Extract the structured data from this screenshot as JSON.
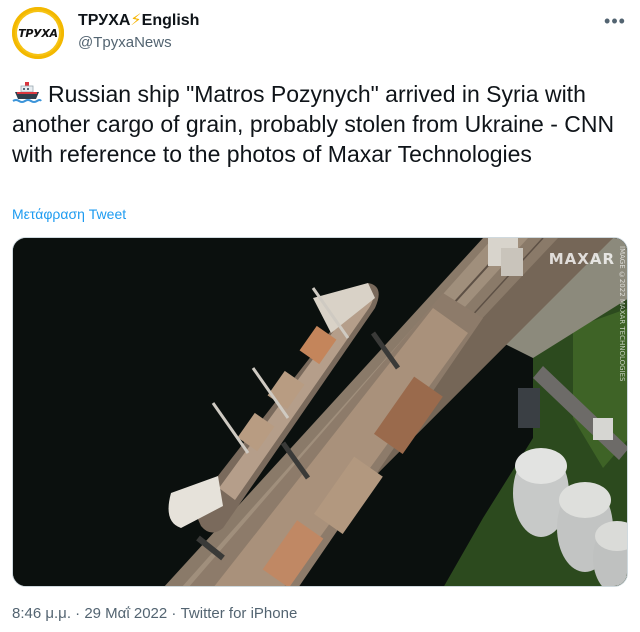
{
  "author": {
    "display_name": "ТРУХА",
    "display_suffix": "English",
    "handle": "@TpyxaNews",
    "avatar_text": "ТРУХА"
  },
  "more_icon": "ellipsis-icon",
  "tweet": {
    "text": "Russian ship \"Matros Pozynych\" arrived in Syria with another cargo of grain, probably stolen from Ukraine - CNN with reference to the photos of Maxar Technologies",
    "emoji_icon": "ship-icon",
    "translate_label": "Μετάφραση Tweet"
  },
  "media": {
    "watermark": "MAXAR",
    "credit_vertical": "IMAGE ©2022 MAXAR TECHNOLOGIES"
  },
  "meta": {
    "time": "8:46 μ.μ.",
    "date": "29 Μαΐ 2022",
    "source": "Twitter for iPhone",
    "separator": " · "
  },
  "colors": {
    "link": "#1d9bf0",
    "secondary": "#536471",
    "avatar": "#f6c314",
    "bolt": "#f5b400"
  }
}
